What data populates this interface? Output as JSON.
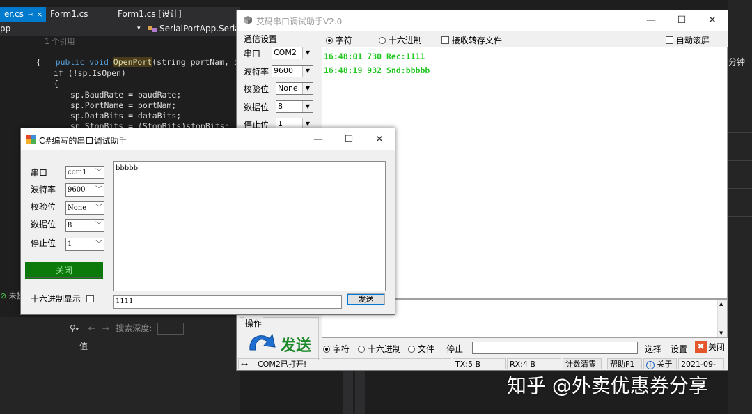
{
  "vs": {
    "tabs": [
      "er.cs",
      "Form1.cs",
      "Form1.cs [设计]"
    ],
    "tab_pin": "⊸",
    "tab_close": "×",
    "nav_left": "pp",
    "nav_mid": "SerialPortApp.Serial",
    "code": {
      "refs": "1 个引用",
      "sig_public": "public void ",
      "sig_method": "OpenPort",
      "sig_params": "(string portNam, int baudR",
      "brace_open": "{",
      "if_line": "if (!sp.IsOpen)",
      "brace_open2": "{",
      "l1": "sp.BaudRate = baudRate;",
      "l2": "sp.PortName = portNam;",
      "l3": "sp.DataBits = dataBits;",
      "l4": "sp.StopBits = (StopBits)stopBits;"
    },
    "status_left": "未抄",
    "search_label": "搜索深度:",
    "value_label": "值",
    "right_label": "分钟"
  },
  "aima": {
    "title": "艾码串口调试助手V2.0",
    "settings_legend": "通信设置",
    "fields": [
      {
        "label": "串口",
        "value": "COM2"
      },
      {
        "label": "波特率",
        "value": "9600"
      },
      {
        "label": "校验位",
        "value": "None"
      },
      {
        "label": "数据位",
        "value": "8"
      },
      {
        "label": "停止位",
        "value": "1"
      }
    ],
    "recv_mode_char": "字符",
    "recv_mode_hex": "十六进制",
    "recv_to_file": "接收转存文件",
    "auto_scroll": "自动滚屏",
    "recv_lines": [
      "16:48:01 730 Rec:1111",
      "16:48:19 932 Snd:bbbbb"
    ],
    "ops_legend": "操作",
    "send_label": "发送",
    "send_mode_char": "字符",
    "send_mode_hex": "十六进制",
    "send_mode_file": "文件",
    "stop_label": "停止",
    "select_label": "选择",
    "settings_label": "设置",
    "close_label": "关闭",
    "status": {
      "port_state": "COM2已打开!",
      "tx": "TX:5 B",
      "rx": "RX:4 B",
      "clear": "计数清零",
      "help": "帮助F1",
      "about": "关于",
      "date": "2021-09-"
    }
  },
  "cs": {
    "title": "C#编写的串口调试助手",
    "fields": [
      {
        "label": "串口",
        "value": "com1"
      },
      {
        "label": "波特率",
        "value": "9600"
      },
      {
        "label": "校验位",
        "value": "None"
      },
      {
        "label": "数据位",
        "value": "8"
      },
      {
        "label": "停止位",
        "value": "1"
      }
    ],
    "close_button": "关闭",
    "hex_display": "十六进制显示",
    "recv_text": "bbbbb",
    "send_text": "1111",
    "send_button": "发送"
  },
  "watermark": "知乎 @外卖优惠券分享",
  "colors": {
    "recv_text": "#22c722",
    "close_button": "#0b7a0b",
    "vs_accent": "#007acc"
  }
}
